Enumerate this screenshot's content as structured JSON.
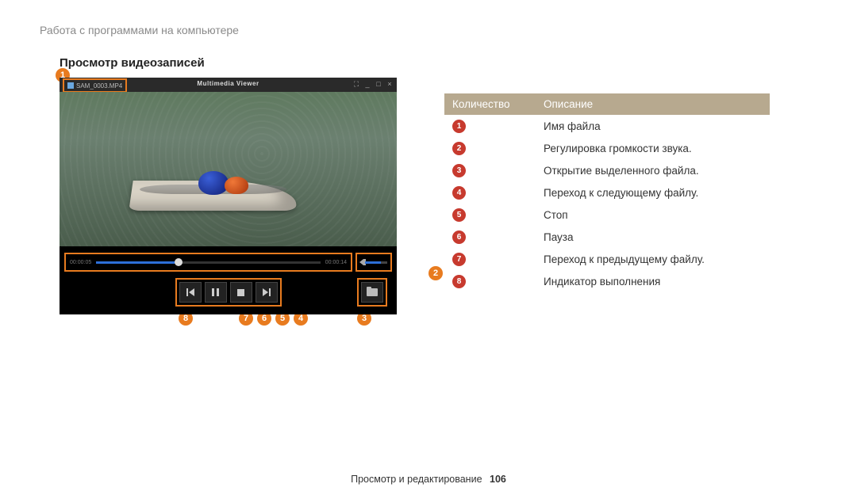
{
  "breadcrumb": "Работа с программами на компьютере",
  "section_title": "Просмотр видеозаписей",
  "viewer": {
    "filename": "SAM_0003.MP4",
    "title": "Multimedia  Viewer",
    "time_left": "00:00:05",
    "time_right": "00:00:14"
  },
  "callouts": {
    "1": "1",
    "2": "2",
    "3": "3",
    "4": "4",
    "5": "5",
    "6": "6",
    "7": "7",
    "8": "8"
  },
  "table": {
    "h1": "Количество",
    "h2": "Описание",
    "rows": [
      {
        "n": "1",
        "d": "Имя файла"
      },
      {
        "n": "2",
        "d": "Регулировка громкости звука."
      },
      {
        "n": "3",
        "d": "Открытие выделенного файла."
      },
      {
        "n": "4",
        "d": "Переход к следующему файлу."
      },
      {
        "n": "5",
        "d": "Стоп"
      },
      {
        "n": "6",
        "d": "Пауза"
      },
      {
        "n": "7",
        "d": "Переход к предыдущему файлу."
      },
      {
        "n": "8",
        "d": "Индикатор выполнения"
      }
    ]
  },
  "footer": {
    "text": "Просмотр и редактирование",
    "page": "106"
  }
}
